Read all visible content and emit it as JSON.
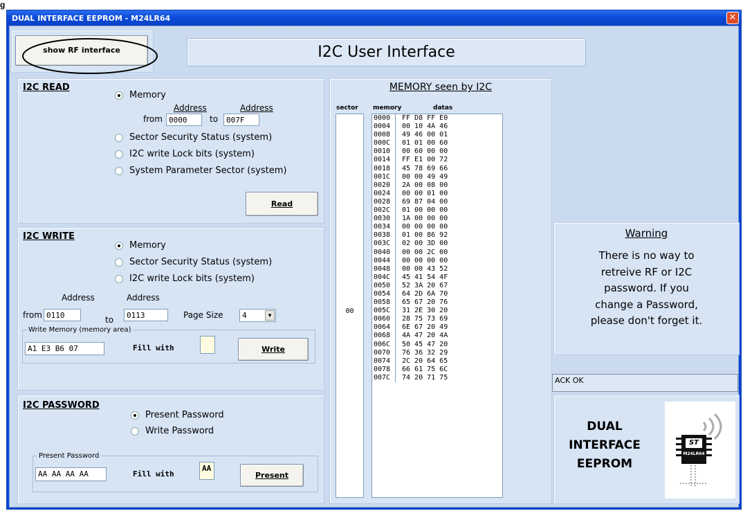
{
  "figure_label": "g",
  "window": {
    "title": "DUAL INTERFACE EEPROM - M24LR64",
    "close_glyph": "✕"
  },
  "top": {
    "show_rf_button": "show  RF interface",
    "banner": "I2C User Interface"
  },
  "read": {
    "header": "I2C READ",
    "options": [
      "Memory",
      "Sector Security Status (system)",
      "I2C write Lock bits (system)",
      "System Parameter Sector (system)"
    ],
    "selected": 0,
    "address_label": "Address",
    "from_label": "from",
    "to_label": "to",
    "from_value": "0000",
    "to_value": "007F",
    "read_button": "Read"
  },
  "write": {
    "header": "I2C WRITE",
    "options": [
      "Memory",
      "Sector Security Status (system)",
      "I2C write Lock bits (system)"
    ],
    "selected": 0,
    "address_label": "Address",
    "from_label": "from",
    "to_label": "to",
    "from_value": "0110",
    "to_value": "0113",
    "page_size_label": "Page Size",
    "page_size_value": "4",
    "group_label": "Write Memory (memory area)",
    "data_value": "A1 E3 B6 07",
    "fill_label": "Fill with",
    "fill_value": "",
    "write_button": "Write"
  },
  "password": {
    "header": "I2C PASSWORD",
    "options": [
      "Present Password",
      "Write Password"
    ],
    "selected": 0,
    "group_label": "Present Password",
    "password_value": "AA AA AA AA",
    "fill_label": "Fill with",
    "fill_value": "AA",
    "present_button": "Present"
  },
  "memory": {
    "title": "MEMORY seen by I2C",
    "col_sector": "sector",
    "col_memory": "memory",
    "col_datas": "datas",
    "sector": "00",
    "addresses": [
      "0000",
      "0004",
      "0008",
      "000C",
      "0010",
      "0014",
      "0018",
      "001C",
      "0020",
      "0024",
      "0028",
      "002C",
      "0030",
      "0034",
      "0038",
      "003C",
      "0040",
      "0044",
      "0048",
      "004C",
      "0050",
      "0054",
      "0058",
      "005C",
      "0060",
      "0064",
      "0068",
      "006C",
      "0070",
      "0074",
      "0078",
      "007C"
    ],
    "datas": [
      "FF D8 FF E0",
      "00 10 4A 46",
      "49 46 00 01",
      "01 01 00 60",
      "00 60 00 00",
      "FF E1 00 72",
      "45 78 69 66",
      "00 00 49 49",
      "2A 00 08 00",
      "00 00 01 00",
      "69 87 04 00",
      "01 00 00 00",
      "1A 00 00 00",
      "00 00 00 00",
      "01 00 86 92",
      "02 00 3D 00",
      "00 00 2C 00",
      "00 00 00 00",
      "00 00 43 52",
      "45 41 54 4F",
      "52 3A 20 67",
      "64 2D 6A 70",
      "65 67 20 76",
      "31 2E 30 20",
      "28 75 73 69",
      "6E 67 20 49",
      "4A 47 20 4A",
      "50 45 47 20",
      "76 36 32 29",
      "2C 20 64 65",
      "66 61 75 6C",
      "74 20 71 75"
    ]
  },
  "warning": {
    "title": "Warning",
    "lines": [
      "There is no way to",
      "retreive RF or I2C",
      "password. If you",
      "change a  Password,",
      "please don't forget it."
    ]
  },
  "status": {
    "text": "ACK OK"
  },
  "logo": {
    "lines": [
      "DUAL",
      "INTERFACE",
      "EEPROM"
    ],
    "chip_brand": "ST",
    "chip_label": "M24LR64",
    "icon": "rfid-chip-icon"
  },
  "colors": {
    "title_bar": "#0b4bd9",
    "panel": "#d7e4f4",
    "client": "#cbdbef",
    "annotation": "#000000",
    "close": "#e04a26"
  }
}
